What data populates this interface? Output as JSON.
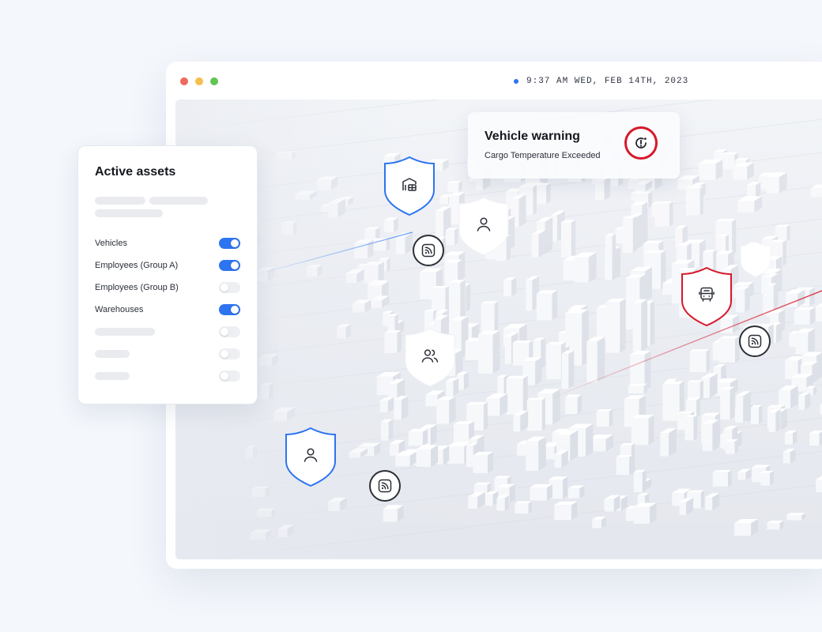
{
  "window": {
    "clock": "9:37 AM WED, FEB 14TH, 2023"
  },
  "assets_panel": {
    "title": "Active assets",
    "items": [
      {
        "label": "Vehicles",
        "enabled": true
      },
      {
        "label": "Employees (Group A)",
        "enabled": true
      },
      {
        "label": "Employees (Group B)",
        "enabled": false
      },
      {
        "label": "Warehouses",
        "enabled": true
      }
    ]
  },
  "warning": {
    "title": "Vehicle warning",
    "message": "Cargo Temperature Exceeded"
  },
  "colors": {
    "accent": "#2d74f0",
    "alert": "#d7182a",
    "toggle_off": "#edeff3"
  },
  "map_markers": [
    {
      "icon": "warehouse-icon",
      "outline": "blue"
    },
    {
      "icon": "person-icon",
      "outline": "none"
    },
    {
      "icon": "group-icon",
      "outline": "none"
    },
    {
      "icon": "person-icon",
      "outline": "blue"
    },
    {
      "icon": "bus-icon",
      "outline": "red"
    },
    {
      "icon": "blank-icon",
      "outline": "none"
    },
    {
      "icon": "rss-feed-icon",
      "outline": "dark"
    },
    {
      "icon": "rss-feed-icon",
      "outline": "dark"
    },
    {
      "icon": "rss-feed-icon",
      "outline": "dark"
    }
  ]
}
